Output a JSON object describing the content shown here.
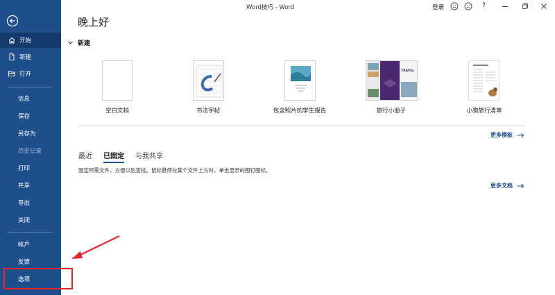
{
  "window": {
    "title": "Word技巧 - Word",
    "login": "登录",
    "help": "?"
  },
  "sidebar": {
    "items": [
      {
        "label": "开始",
        "icon": "home-icon"
      },
      {
        "label": "新建",
        "icon": "new-file-icon"
      },
      {
        "label": "打开",
        "icon": "folder-icon"
      },
      {
        "label": "信息"
      },
      {
        "label": "保存"
      },
      {
        "label": "另存为"
      },
      {
        "label": "历史记录"
      },
      {
        "label": "打印"
      },
      {
        "label": "共享"
      },
      {
        "label": "导出"
      },
      {
        "label": "关闭"
      },
      {
        "label": "帐户"
      },
      {
        "label": "反馈"
      },
      {
        "label": "选项"
      }
    ]
  },
  "main": {
    "greeting": "晚上好",
    "new_section": "新建",
    "templates": [
      {
        "label": "空白文档"
      },
      {
        "label": "书法字帖"
      },
      {
        "label": "包含照片的学生报告"
      },
      {
        "label": "旅行小册子",
        "thumb_text": "TRAVEL"
      },
      {
        "label": "小狗旅行清单"
      }
    ],
    "more_templates": "更多模板",
    "tabs": [
      {
        "label": "最近"
      },
      {
        "label": "已固定"
      },
      {
        "label": "与我共享"
      }
    ],
    "hint": "固定所需文件，方便以后查找。鼠标悬停在某个文件上方时，单击显示的图钉图标。",
    "more_docs": "更多文档"
  },
  "colors": {
    "sidebar": "#1e4e8c",
    "accent": "#1e4e8c",
    "annotation": "#e8262b"
  }
}
